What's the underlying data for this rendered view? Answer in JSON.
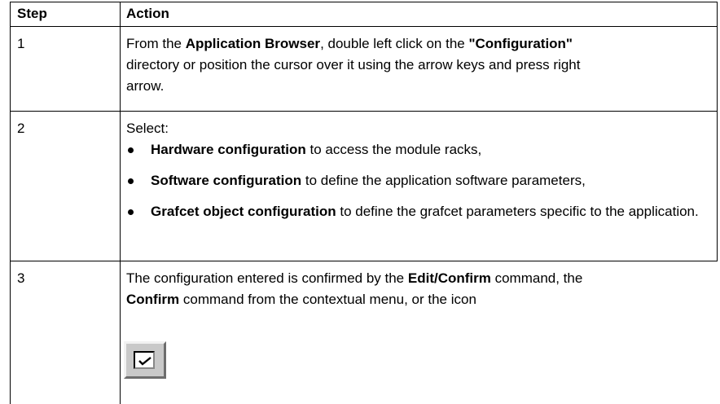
{
  "table": {
    "header": {
      "step": "Step",
      "action": "Action"
    },
    "rows": [
      {
        "step": "1",
        "line1_pre": "From the ",
        "line1_bold1": "Application Browser",
        "line1_mid": ", double left click on the ",
        "line1_bold2": "\"Configuration\"",
        "line2": "directory or position the cursor over it using the arrow keys and press right",
        "line3": "arrow."
      },
      {
        "step": "2",
        "intro": "Select:",
        "bullets": [
          {
            "bold": "Hardware configuration",
            "text": " to access the module racks,"
          },
          {
            "bold": "Software configuration",
            "text": " to define the application software parameters,"
          },
          {
            "bold": "Grafcet object configuration",
            "text": " to define the grafcet parameters specific to the application."
          }
        ]
      },
      {
        "step": "3",
        "line1_pre": "The configuration entered is confirmed by the ",
        "line1_bold": "Edit/Confirm",
        "line1_post": " command, the",
        "line2_bold": "Confirm",
        "line2_post": " command from the contextual menu, or the icon",
        "icon": "confirm-check-icon"
      }
    ]
  }
}
